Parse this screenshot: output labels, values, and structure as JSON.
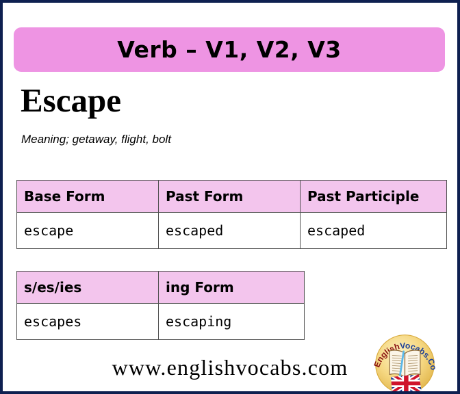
{
  "page": {
    "border_color": "#0e2050",
    "background": "#ffffff"
  },
  "banner": {
    "label": "Verb – V1, V2, V3",
    "color": "#ee94e3"
  },
  "word": {
    "title": "Escape",
    "meaning": "Meaning; getaway, flight, bolt"
  },
  "table_main": {
    "header_color": "#f3c5ed",
    "headers": [
      "Base Form",
      "Past Form",
      "Past Participle"
    ],
    "row": [
      "escape",
      "escaped",
      "escaped"
    ]
  },
  "table_second": {
    "header_color": "#f3c5ed",
    "headers": [
      "s/es/ies",
      "ing Form"
    ],
    "row": [
      "escapes",
      "escaping"
    ]
  },
  "footer": {
    "site_url": "www.englishvocabs.com"
  },
  "logo": {
    "text_part1": "English",
    "text_part2": "Vocabs.Com",
    "part1_color": "#8a1010",
    "part2_color": "#1c3f97",
    "badge_color": "#f2d67a",
    "icon_book": "open-book-icon",
    "icon_flag": "uk-flag-icon"
  }
}
